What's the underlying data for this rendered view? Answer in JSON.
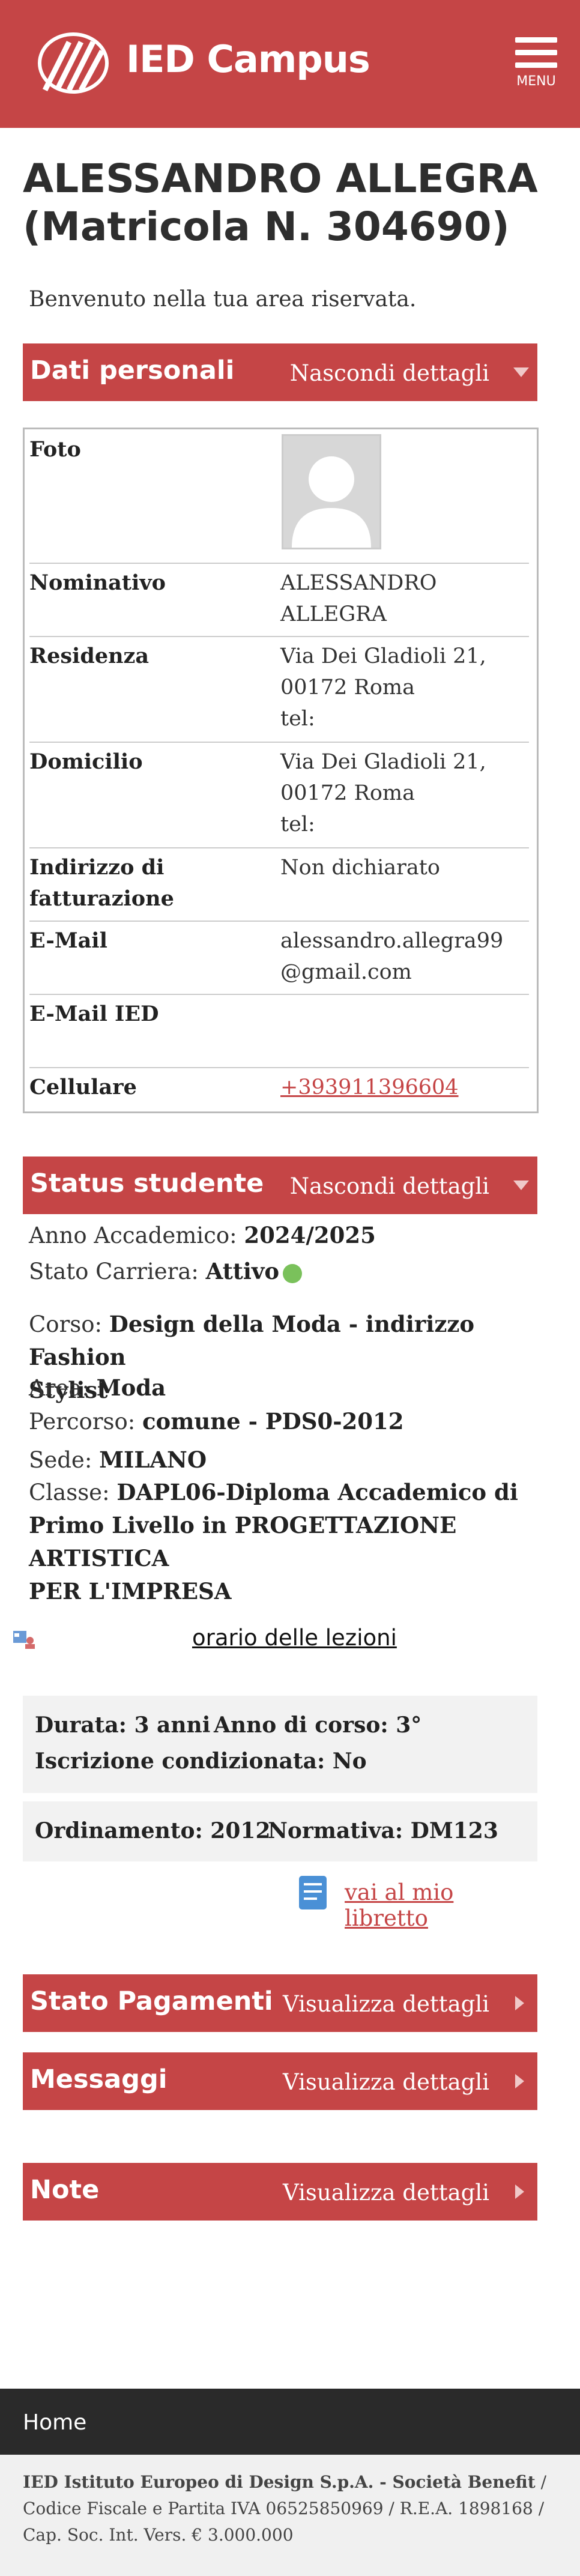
{
  "header": {
    "brand": "IED Campus",
    "menu_label": "MENU"
  },
  "page_title": "ALESSANDRO ALLEGRA (Matricola N. 304690)",
  "welcome": "Benvenuto nella tua area riservata.",
  "personal": {
    "section_title": "Dati personali",
    "toggle": "Nascondi dettagli",
    "rows": {
      "foto": "Foto",
      "nominativo": {
        "label": "Nominativo",
        "l1": "ALESSANDRO",
        "l2": "ALLEGRA"
      },
      "residenza": {
        "label": "Residenza",
        "l1": "Via Dei Gladioli 21,",
        "l2": "00172 Roma",
        "l3": "tel:"
      },
      "domicilio": {
        "label": "Domicilio",
        "l1": "Via Dei Gladioli 21,",
        "l2": "00172 Roma",
        "l3": "tel:"
      },
      "fatturazione": {
        "label1": "Indirizzo di",
        "label2": "fatturazione",
        "value": "Non dichiarato"
      },
      "email": {
        "label": "E-Mail",
        "l1": "alessandro.allegra99",
        "l2": "@gmail.com"
      },
      "email_ied": {
        "label": "E-Mail IED",
        "value": ""
      },
      "cellulare": {
        "label": "Cellulare",
        "value": "+393911396604"
      }
    }
  },
  "status": {
    "section_title": "Status studente",
    "toggle": "Nascondi dettagli",
    "anno_label": "Anno Accademico:",
    "anno_value": "2024/2025",
    "carriera_label": "Stato Carriera:",
    "carriera_value": "Attivo",
    "corso_label": "Corso:",
    "corso_value1": "Design della Moda - indirizzo Fashion",
    "corso_value2": "Stylist",
    "area_label": "Area:",
    "area_value": "Moda",
    "percorso_label": "Percorso:",
    "percorso_value": "comune - PDS0-2012",
    "sede_label": "Sede:",
    "sede_value": "MILANO",
    "classe_label": "Classe:",
    "classe_value1": "DAPL06-Diploma Accademico di",
    "classe_value2": "Primo Livello in PROGETTAZIONE ARTISTICA",
    "classe_value3": "PER L'IMPRESA",
    "status_color": "#7ac15b"
  },
  "orario_link": "orario delle lezioni",
  "info1": {
    "durata": "Durata: 3 anni",
    "anno_corso": "Anno di corso: 3°",
    "iscrizione": "Iscrizione condizionata: No"
  },
  "info2": {
    "ordinamento": "Ordinamento: 2012",
    "normativa": "Normativa: DM123"
  },
  "libretto_link": "vai al mio libretto",
  "sections": [
    {
      "title": "Stato Pagamenti",
      "action": "Visualizza dettagli"
    },
    {
      "title": "Messaggi",
      "action": "Visualizza dettagli"
    },
    {
      "title": "Note",
      "action": "Visualizza dettagli"
    }
  ],
  "footer": {
    "home": "Home"
  },
  "legal": {
    "company": "IED Istituto Europeo di Design S.p.A. - Società Benefit",
    "details": " / Codice Fiscale e Partita IVA 06525850969 / R.E.A. 1898168 / Cap. Soc. Int. Vers. € 3.000.000"
  },
  "colors": {
    "brand": "#c54546",
    "footer": "#2a2a2a",
    "status_active": "#7ac15b"
  }
}
